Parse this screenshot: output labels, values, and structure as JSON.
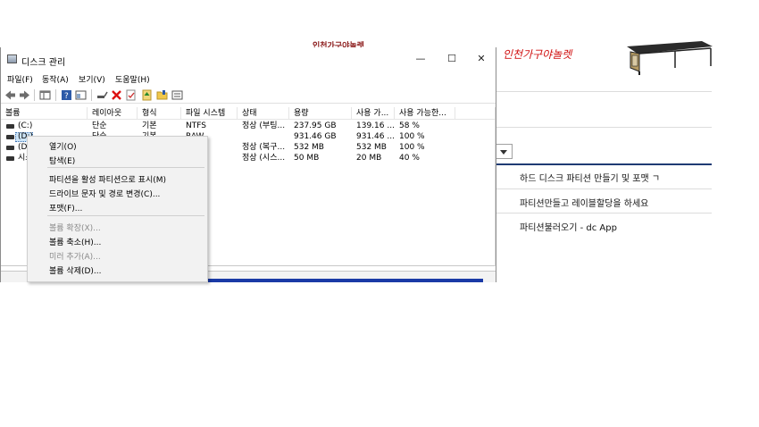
{
  "background_page": {
    "banner_text": "인천가구야놀렛",
    "handwriting": "인천가구야놀렛",
    "links": [
      "하드 디스크 파티션 만들기 및 포맷 ㄱ",
      "파티션만들고 레이블할당을 하세요",
      "파티션불러오기 - dc App"
    ]
  },
  "window": {
    "title": "디스크 관리",
    "controls": {
      "minimize": "—",
      "maximize": "☐",
      "close": "✕"
    },
    "menu": [
      "파일(F)",
      "동작(A)",
      "보기(V)",
      "도움말(H)"
    ],
    "toolbar_icons": [
      "back-icon",
      "forward-icon",
      "console-icon",
      "help-icon",
      "properties-icon",
      "connect-icon",
      "delete-icon",
      "check-icon",
      "up-icon",
      "folder-icon",
      "list-icon"
    ],
    "columns": [
      "볼륨",
      "레이아웃",
      "형식",
      "파일 시스템",
      "상태",
      "용량",
      "사용 가...",
      "사용 가능한..."
    ],
    "rows": [
      {
        "volume": "(C:)",
        "layout": "단순",
        "type": "기본",
        "fs": "NTFS",
        "status": "정상 (부팅...",
        "capacity": "237.95 GB",
        "free": "139.16 ...",
        "pct": "58 %"
      },
      {
        "volume": "(D:)",
        "layout": "단순",
        "type": "기본",
        "fs": "RAW",
        "status": "",
        "capacity": "931.46 GB",
        "free": "931.46 ...",
        "pct": "100 %"
      },
      {
        "volume": "(D",
        "layout": "",
        "type": "",
        "fs": "",
        "status": "정상 (복구...",
        "capacity": "532 MB",
        "free": "532 MB",
        "pct": "100 %"
      },
      {
        "volume": "시스",
        "layout": "",
        "type": "",
        "fs": "",
        "status": "정상 (시스...",
        "capacity": "50 MB",
        "free": "20 MB",
        "pct": "40 %"
      }
    ]
  },
  "context_menu": {
    "groups": [
      [
        {
          "label": "열기(O)",
          "enabled": true
        },
        {
          "label": "탐색(E)",
          "enabled": true
        }
      ],
      [
        {
          "label": "파티션을 활성 파티션으로 표시(M)",
          "enabled": true
        },
        {
          "label": "드라이브 문자 및 경로 변경(C)...",
          "enabled": true
        },
        {
          "label": "포맷(F)...",
          "enabled": true
        }
      ],
      [
        {
          "label": "볼륨 확장(X)...",
          "enabled": false
        },
        {
          "label": "볼륨 축소(H)...",
          "enabled": true
        },
        {
          "label": "미러 추가(A)...",
          "enabled": false
        },
        {
          "label": "볼륨 삭제(D)...",
          "enabled": true
        }
      ]
    ]
  },
  "colors": {
    "accent_blue": "#1a3aa6",
    "selection": "#cde4f7",
    "handwriting_red": "#d01010"
  }
}
